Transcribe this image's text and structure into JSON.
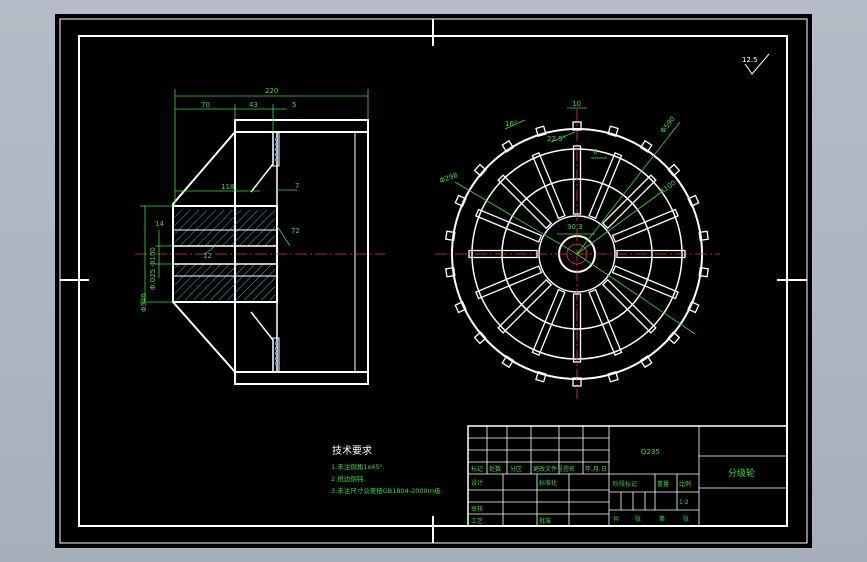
{
  "drawing": {
    "roughness_symbol": "12.5",
    "dimensions": {
      "overall_width": "220",
      "hub_left": "70",
      "mid": "43",
      "rim": "5",
      "inner_len": "118",
      "thickness": "7",
      "key_depth": "14",
      "key_width": "72",
      "dia_100": "Φ100",
      "dia_40": "Φ40",
      "tol": "Φ.025",
      "dia_hole": "Φ340",
      "small_12": "12",
      "top_10": "10",
      "top_16": "16°",
      "angle": "22.5°",
      "slot_6": "6",
      "r_590": "Φ590",
      "r_298": "Φ298",
      "r_100": "R100",
      "r_30": "30.3"
    },
    "tech_req": {
      "title": "技术要求",
      "lines": [
        "1.未注倒角1x45°.",
        "2.锐边倒钝.",
        "3.未注尺寸公差按GB1804-2000m级."
      ]
    },
    "title_block": {
      "material": "Q235",
      "part_name": "分级轮",
      "scale_label": "比例",
      "scale": "1:2",
      "weight_label": "重量",
      "stage_label": "阶段标记",
      "cells_row1": [
        "标记",
        "处数",
        "分区",
        "更改文件号",
        "签名",
        "年.月.日"
      ],
      "design": "设计",
      "standard": "标准化",
      "review": "审核",
      "process": "工艺",
      "approve": "批准",
      "sheet": [
        "共",
        "张",
        "第",
        "张"
      ]
    }
  }
}
